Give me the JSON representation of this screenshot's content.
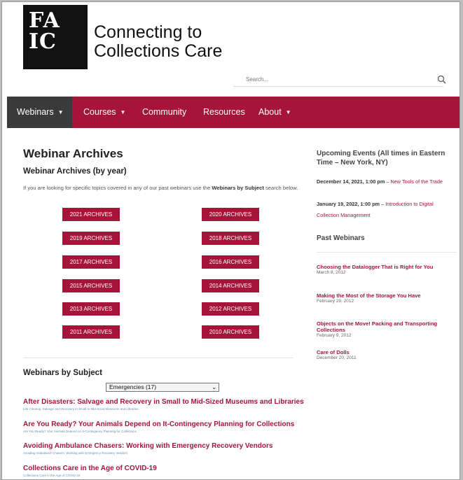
{
  "brand": {
    "logo_text": "FA\nIC",
    "site_title": "Connecting to\nCollections Care",
    "brand_color": "#a6143a"
  },
  "search": {
    "placeholder": "Search..."
  },
  "nav": {
    "items": [
      {
        "label": "Webinars",
        "caret": "▼",
        "active": true
      },
      {
        "label": "Courses",
        "caret": "▼"
      },
      {
        "label": "Community"
      },
      {
        "label": "Resources"
      },
      {
        "label": "About",
        "caret": "▼"
      }
    ]
  },
  "main": {
    "heading": "Webinar Archives",
    "subheading": "Webinar Archives (by year)",
    "intro_before": "If you are looking for specific topics covered in any of our past webinars use the ",
    "intro_bold": "Webinars by Subject",
    "intro_after": " search below.",
    "archive_buttons": [
      "2021 ARCHIVES",
      "2020 ARCHIVES",
      "2019 ARCHIVES",
      "2018 ARCHIVES",
      "2017 ARCHIVES",
      "2016 ARCHIVES",
      "2015 ARCHIVES",
      "2014 ARCHIVES",
      "2013 ARCHIVES",
      "2012 ARCHIVES",
      "2011 ARCHIVES",
      "2010 ARCHIVES"
    ],
    "subject_heading": "Webinars by Subject",
    "subject_selected": "Emergencies (17)",
    "webinars": [
      {
        "title": "After Disasters: Salvage and Recovery in Small to Mid-Sized Museums and Libraries",
        "sub": "Life Cleanup, Salvage and Recovery in Small to Mid-Sized Museums and Libraries"
      },
      {
        "title": "Are You Ready? Your Animals Depend on It-Contingency Planning for Collections",
        "sub": "Are You Ready? Your Animals Depend on It-Contingency Planning for Collections"
      },
      {
        "title": "Avoiding Ambulance Chasers: Working with Emergency Recovery Vendors",
        "sub": "Avoiding Ambulance Chasers: Working with Emergency Recovery Vendors"
      },
      {
        "title": "Collections Care in the Age of COVID-19",
        "sub": "Collections Care in the Age of COVID-19"
      }
    ]
  },
  "sidebar": {
    "upcoming_heading": "Upcoming Events (All times in Eastern Time – New York, NY)",
    "events": [
      {
        "date": "December 14, 2021, 1:00 pm",
        "sep": " – ",
        "title": "New Tools of the Trade"
      },
      {
        "date": "January 19, 2022, 1:00 pm",
        "sep": " – ",
        "title": "Introduction to Digital Collection Management"
      }
    ],
    "past_heading": "Past Webinars",
    "past": [
      {
        "title": "Choosing the Datalogger That is Right for You",
        "date": "March 8, 2012"
      },
      {
        "title": "Making the Most of the Storage You Have",
        "date": "February 29, 2012"
      },
      {
        "title": "Objects on the Move! Packing and Transporting Collections",
        "date": "February 9, 2012"
      },
      {
        "title": "Care of Dolls",
        "date": "December 20, 2011"
      }
    ]
  }
}
